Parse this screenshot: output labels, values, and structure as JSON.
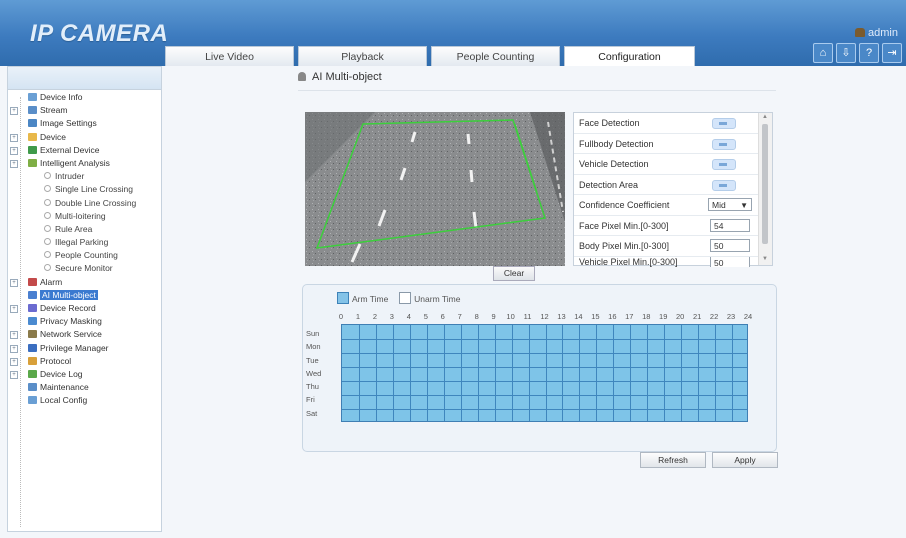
{
  "header": {
    "logo": "IP CAMERA",
    "user": "admin",
    "icons": [
      "home-icon",
      "download-icon",
      "help-icon",
      "logout-icon"
    ]
  },
  "tabs": [
    {
      "label": "Live Video",
      "active": false
    },
    {
      "label": "Playback",
      "active": false
    },
    {
      "label": "People Counting",
      "active": false
    },
    {
      "label": "Configuration",
      "active": true
    }
  ],
  "sidebar": {
    "items": [
      {
        "label": "Device Info",
        "level": 1,
        "icon": "device-info-icon",
        "expandable": false
      },
      {
        "label": "Stream",
        "level": 1,
        "icon": "stream-icon",
        "expandable": true
      },
      {
        "label": "Image Settings",
        "level": 1,
        "icon": "image-icon",
        "expandable": false
      },
      {
        "label": "Device",
        "level": 1,
        "icon": "folder-icon",
        "expandable": true
      },
      {
        "label": "External Device",
        "level": 1,
        "icon": "external-device-icon",
        "expandable": true
      },
      {
        "label": "Intelligent Analysis",
        "level": 1,
        "icon": "analysis-icon",
        "expandable": true
      },
      {
        "label": "Intruder",
        "level": 2
      },
      {
        "label": "Single Line Crossing",
        "level": 2
      },
      {
        "label": "Double Line Crossing",
        "level": 2
      },
      {
        "label": "Multi-loitering",
        "level": 2
      },
      {
        "label": "Rule Area",
        "level": 2
      },
      {
        "label": "Illegal Parking",
        "level": 2
      },
      {
        "label": "People Counting",
        "level": 2
      },
      {
        "label": "Secure Monitor",
        "level": 2
      },
      {
        "label": "Alarm",
        "level": 1,
        "icon": "alarm-icon",
        "expandable": true
      },
      {
        "label": "AI Multi-object",
        "level": 1,
        "icon": "ai-multi-object-icon",
        "expandable": false,
        "selected": true
      },
      {
        "label": "Device Record",
        "level": 1,
        "icon": "record-icon",
        "expandable": true
      },
      {
        "label": "Privacy Masking",
        "level": 1,
        "icon": "privacy-icon",
        "expandable": false
      },
      {
        "label": "Network Service",
        "level": 1,
        "icon": "network-icon",
        "expandable": true
      },
      {
        "label": "Privilege Manager",
        "level": 1,
        "icon": "privilege-icon",
        "expandable": true
      },
      {
        "label": "Protocol",
        "level": 1,
        "icon": "protocol-icon",
        "expandable": true
      },
      {
        "label": "Device Log",
        "level": 1,
        "icon": "log-icon",
        "expandable": true
      },
      {
        "label": "Maintenance",
        "level": 1,
        "icon": "maintenance-icon",
        "expandable": false
      },
      {
        "label": "Local Config",
        "level": 1,
        "icon": "local-config-icon",
        "expandable": false
      }
    ]
  },
  "page": {
    "title": "AI Multi-object",
    "clear_label": "Clear",
    "settings": {
      "face_detection": {
        "label": "Face Detection"
      },
      "fullbody_detection": {
        "label": "Fullbody Detection"
      },
      "vehicle_detection": {
        "label": "Vehicle Detection"
      },
      "detection_area": {
        "label": "Detection Area"
      },
      "confidence": {
        "label": "Confidence Coefficient",
        "value": "Mid"
      },
      "face_pixel": {
        "label": "Face Pixel Min.[0-300]",
        "value": "54"
      },
      "body_pixel": {
        "label": "Body Pixel Min.[0-300]",
        "value": "50"
      },
      "vehicle_pixel": {
        "label": "Vehicle Pixel Min.[0-300]",
        "value": "50"
      }
    },
    "schedule": {
      "arm_label": "Arm Time",
      "unarm_label": "Unarm Time",
      "hours": [
        "0",
        "1",
        "2",
        "3",
        "4",
        "5",
        "6",
        "7",
        "8",
        "9",
        "10",
        "11",
        "12",
        "13",
        "14",
        "15",
        "16",
        "17",
        "18",
        "19",
        "20",
        "21",
        "22",
        "23",
        "24"
      ],
      "days": [
        "Sun",
        "Mon",
        "Tue",
        "Wed",
        "Thu",
        "Fri",
        "Sat"
      ]
    },
    "refresh_label": "Refresh",
    "apply_label": "Apply"
  }
}
